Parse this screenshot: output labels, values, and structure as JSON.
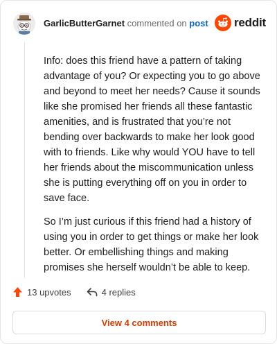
{
  "comment": {
    "username": "GarlicButterGarnet",
    "commented_text": "commented on",
    "post_link": "post",
    "paragraphs": [
      "Info: does this friend have a pattern of taking advantage of you? Or expecting you to go above and beyond to meet her needs? Cause it sounds like she promised her friends all these fantastic amenities, and is frustrated that you’re not bending over backwards to make her look good with to friends. Like why would YOU have to tell her friends about the miscommunication unless she is putting everything off on you in order to save face.",
      "So I’m just curious if this friend had a history of using you in order to get things or make her look better. Or embellishing things and making promises she herself wouldn’t be able to keep."
    ]
  },
  "brand": {
    "name": "reddit",
    "color": "#ff4500"
  },
  "footer": {
    "upvotes": "13 upvotes",
    "replies": "4 replies",
    "view_comments": "View 4 comments"
  },
  "icons": {
    "avatar": "snoo-avatar-icon",
    "upvote": "upvote-arrow-icon",
    "reply": "reply-arrow-icon",
    "brand": "reddit-snoo-icon"
  },
  "colors": {
    "upvote": "#ff4500",
    "link": "#0a66c2",
    "view_button_text": "#d93a00"
  }
}
